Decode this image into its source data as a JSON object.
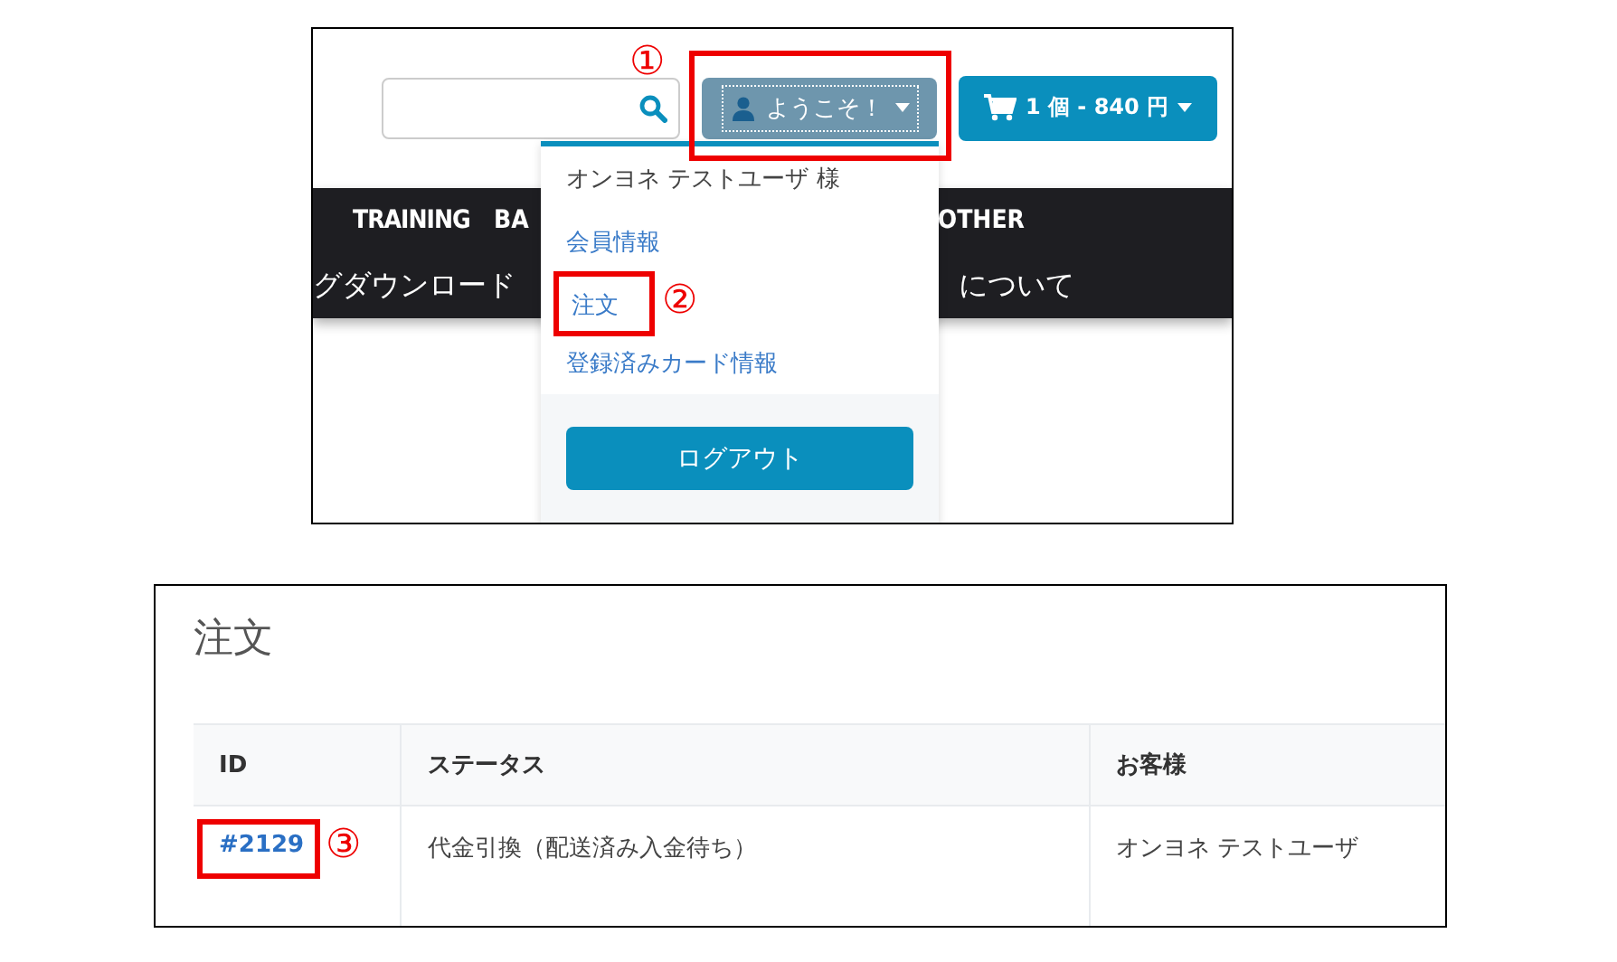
{
  "header": {
    "user_button": {
      "label": "ようこそ！"
    },
    "cart_button": {
      "label": "1 個 - 840 円"
    }
  },
  "nav": {
    "row_1": [
      "TRAINING",
      "BA",
      "OTHER"
    ],
    "row_2": [
      "グダウンロード",
      "について"
    ]
  },
  "dropdown": {
    "user_name": "オンヨネ テストユーザ 様",
    "links": [
      {
        "label": "会員情報",
        "annotated": false
      },
      {
        "label": "注文",
        "annotated": true
      },
      {
        "label": "登録済みカード情報",
        "annotated": false
      }
    ],
    "logout_button": "ログアウト"
  },
  "orders": {
    "title": "注文",
    "table": {
      "columns": [
        "ID",
        "ステータス",
        "お客様"
      ],
      "rows": [
        [
          "#2129",
          "代金引換（配送済み入金待ち）",
          "オンヨネ テストユーザ"
        ]
      ]
    }
  },
  "annotations": [
    "①",
    "②",
    "③"
  ]
}
